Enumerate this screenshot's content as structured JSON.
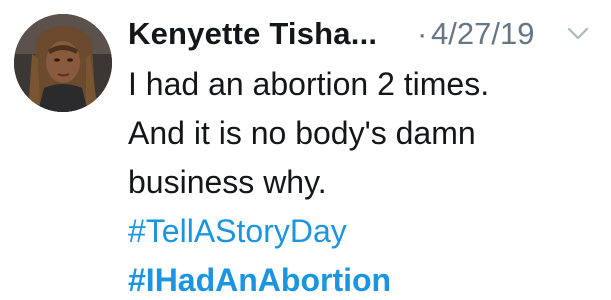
{
  "tweet": {
    "author_name": "Kenyette Tisha...",
    "separator": "·",
    "date": "4/27/19",
    "body_lines": [
      "I had an abortion 2 times.",
      "And it is no body's damn",
      "business why."
    ],
    "hashtags": [
      "#TellAStoryDay",
      "#IHadAnAbortion"
    ]
  },
  "icons": {
    "avatar": "avatar",
    "menu": "chevron-down-icon"
  },
  "colors": {
    "text": "#14171a",
    "muted": "#657786",
    "link": "#1b95e0",
    "background": "#ffffff"
  }
}
